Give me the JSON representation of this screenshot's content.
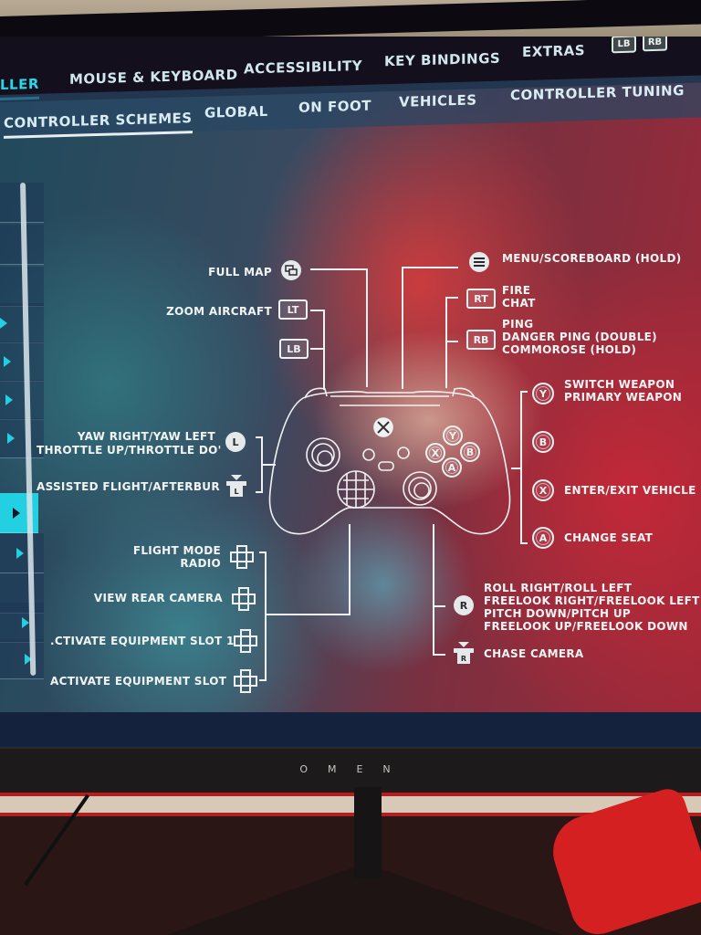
{
  "top_nav": {
    "tabs": [
      {
        "label": "LLER",
        "active": true
      },
      {
        "label": "MOUSE & KEYBOARD",
        "active": false
      },
      {
        "label": "ACCESSIBILITY",
        "active": false
      },
      {
        "label": "KEY BINDINGS",
        "active": false
      },
      {
        "label": "EXTRAS",
        "active": false
      }
    ],
    "bumper_left": "LB",
    "bumper_right": "RB"
  },
  "sub_nav": {
    "tabs": [
      {
        "label": "CONTROLLER SCHEMES",
        "active": true
      },
      {
        "label": "GLOBAL",
        "active": false
      },
      {
        "label": "ON FOOT",
        "active": false
      },
      {
        "label": "VEHICLES",
        "active": false
      },
      {
        "label": "CONTROLLER TUNING",
        "active": false
      }
    ]
  },
  "sidebar": {
    "selected_index": 7,
    "items_count": 12
  },
  "bindings": {
    "full_map": {
      "button": "view",
      "label": "FULL MAP"
    },
    "lt": {
      "button": "LT",
      "label": "ZOOM AIRCRAFT"
    },
    "lb": {
      "button": "LB",
      "label": ""
    },
    "menu": {
      "button": "menu",
      "label": "MENU/SCOREBOARD (HOLD)"
    },
    "rt": {
      "button": "RT",
      "lines": [
        "FIRE",
        "CHAT"
      ]
    },
    "rb": {
      "button": "RB",
      "lines": [
        "PING",
        "DANGER PING (DOUBLE)",
        "COMMOROSE (HOLD)"
      ]
    },
    "y": {
      "button": "Y",
      "lines": [
        "SWITCH WEAPON",
        "PRIMARY WEAPON"
      ]
    },
    "b": {
      "button": "B",
      "label": ""
    },
    "x": {
      "button": "X",
      "label": "ENTER/EXIT VEHICLE"
    },
    "a": {
      "button": "A",
      "label": "CHANGE SEAT"
    },
    "left_stick": {
      "button": "L",
      "lines": [
        "YAW RIGHT/YAW LEFT",
        "THROTTLE UP/THROTTLE DO'"
      ]
    },
    "left_stick_click": {
      "button": "L",
      "label": "ASSISTED FLIGHT/AFTERBUR"
    },
    "dpad_up": {
      "lines": [
        "FLIGHT MODE",
        "RADIO"
      ]
    },
    "dpad_down": {
      "label": "VIEW REAR CAMERA"
    },
    "dpad_left": {
      "label": ".CTIVATE EQUIPMENT SLOT 1"
    },
    "dpad_right": {
      "label": "ACTIVATE EQUIPMENT SLOT"
    },
    "right_stick": {
      "button": "R",
      "lines": [
        "ROLL RIGHT/ROLL LEFT",
        "FREELOOK RIGHT/FREELOOK LEFT",
        "PITCH DOWN/PITCH UP",
        "FREELOOK UP/FREELOOK DOWN"
      ]
    },
    "right_stick_click": {
      "button": "R",
      "label": "CHASE CAMERA"
    }
  },
  "controller_face": {
    "y": "Y",
    "b": "B",
    "x": "X",
    "a": "A"
  },
  "monitor": {
    "brand": "OMEN"
  },
  "colors": {
    "accent": "#27d8e8",
    "nav_bg": "#140f1c",
    "text": "#e8eef0"
  }
}
